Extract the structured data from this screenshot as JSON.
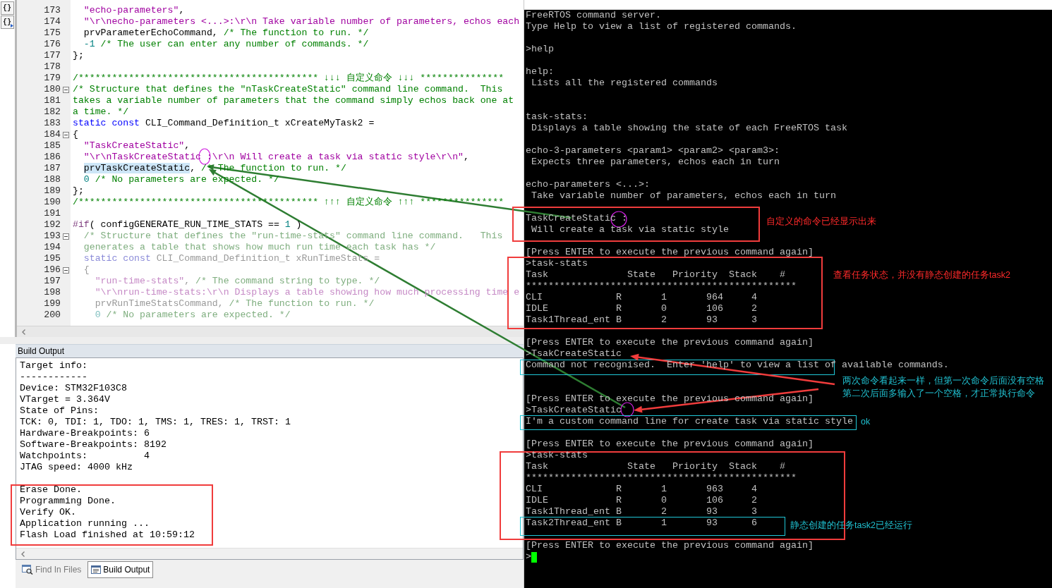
{
  "toolbar": [
    {
      "kind": "braces",
      "label": "{}"
    },
    {
      "kind": "braces_arrow",
      "label": "{}"
    }
  ],
  "editor": {
    "lines": [
      {
        "number": "173",
        "fold": false,
        "inactive": false,
        "tokens": [
          {
            "kind": "string",
            "text": "  \"echo-parameters\""
          },
          {
            "kind": "plain",
            "text": ","
          }
        ]
      },
      {
        "number": "174",
        "fold": false,
        "inactive": false,
        "tokens": [
          {
            "kind": "string",
            "text": "  \"\\r\\necho-parameters <...>:\\r\\n Take variable number of parameters, echos each"
          }
        ]
      },
      {
        "number": "175",
        "fold": false,
        "inactive": false,
        "tokens": [
          {
            "kind": "plain",
            "text": "  prvParameterEchoCommand, "
          },
          {
            "kind": "comment",
            "text": "/* The function to run. */"
          }
        ]
      },
      {
        "number": "176",
        "fold": false,
        "inactive": false,
        "tokens": [
          {
            "kind": "number",
            "text": "  -1"
          },
          {
            "kind": "comment",
            "text": " /* The user can enter any number of commands. */"
          }
        ]
      },
      {
        "number": "177",
        "fold": false,
        "inactive": false,
        "tokens": [
          {
            "kind": "plain",
            "text": "};"
          }
        ]
      },
      {
        "number": "178",
        "fold": false
      },
      {
        "number": "179",
        "fold": false,
        "inactive": false,
        "tokens": [
          {
            "kind": "comment",
            "text": "/******************************************* ↓↓↓ 自定义命令 ↓↓↓ ***************"
          }
        ]
      },
      {
        "number": "180",
        "fold": true,
        "inactive": false,
        "tokens": [
          {
            "kind": "comment",
            "text": "/* Structure that defines the \"nTaskCreateStatic\" command line command.  This"
          }
        ]
      },
      {
        "number": "181",
        "fold": false,
        "inactive": false,
        "tokens": [
          {
            "kind": "comment",
            "text": "takes a variable number of parameters that the command simply echos back one at"
          }
        ]
      },
      {
        "number": "182",
        "fold": false,
        "inactive": false,
        "tokens": [
          {
            "kind": "comment",
            "text": "a time. */"
          }
        ]
      },
      {
        "number": "183",
        "fold": false,
        "inactive": false,
        "tokens": [
          {
            "kind": "keyword",
            "text": "static const"
          },
          {
            "kind": "plain",
            "text": " CLI_Command_Definition_t xCreateMyTask2 ="
          }
        ]
      },
      {
        "number": "184",
        "fold": true,
        "inactive": false,
        "tokens": [
          {
            "kind": "plain",
            "text": "{"
          }
        ]
      },
      {
        "number": "185",
        "fold": false,
        "inactive": false,
        "tokens": [
          {
            "kind": "string",
            "text": "  \"TaskCreateStatic\""
          },
          {
            "kind": "plain",
            "text": ","
          }
        ]
      },
      {
        "number": "186",
        "fold": false,
        "inactive": false,
        "tokens": [
          {
            "kind": "string",
            "text": "  \"\\r\\nTaskCreateStatic :\\r\\n Will create a task via static style\\r\\n\""
          },
          {
            "kind": "plain",
            "text": ","
          }
        ]
      },
      {
        "number": "187",
        "fold": false,
        "inactive": false,
        "tokens": [
          {
            "kind": "highlight",
            "text": "  prvTaskCreateStatic"
          },
          {
            "kind": "plain",
            "text": ", "
          },
          {
            "kind": "comment",
            "text": "/* The function to run. */"
          }
        ]
      },
      {
        "number": "188",
        "fold": false,
        "inactive": false,
        "tokens": [
          {
            "kind": "number",
            "text": "  0"
          },
          {
            "kind": "comment",
            "text": " /* No parameters are expected. */"
          }
        ]
      },
      {
        "number": "189",
        "fold": false,
        "inactive": false,
        "tokens": [
          {
            "kind": "plain",
            "text": "};"
          }
        ]
      },
      {
        "number": "190",
        "fold": false,
        "inactive": false,
        "tokens": [
          {
            "kind": "comment",
            "text": "/******************************************* ↑↑↑ 自定义命令 ↑↑↑ ***************"
          }
        ]
      },
      {
        "number": "191",
        "fold": false
      },
      {
        "number": "192",
        "fold": false,
        "inactive": false,
        "tokens": [
          {
            "kind": "preproc",
            "text": "#if"
          },
          {
            "kind": "plain",
            "text": "( configGENERATE_RUN_TIME_STATS == "
          },
          {
            "kind": "number",
            "text": "1"
          },
          {
            "kind": "plain",
            "text": " )"
          }
        ]
      },
      {
        "number": "193",
        "fold": true,
        "inactive": true,
        "tokens": [
          {
            "kind": "comment",
            "text": "  /* Structure that defines the \"run-time-stats\" command line command.   This"
          }
        ]
      },
      {
        "number": "194",
        "fold": false,
        "inactive": true,
        "tokens": [
          {
            "kind": "comment",
            "text": "  generates a table that shows how much run time each task has */"
          }
        ]
      },
      {
        "number": "195",
        "fold": false,
        "inactive": true,
        "tokens": [
          {
            "kind": "keyword",
            "text": "  static const"
          },
          {
            "kind": "plain",
            "text": " CLI_Command_Definition_t xRunTimeStats ="
          }
        ]
      },
      {
        "number": "196",
        "fold": true,
        "inactive": true,
        "tokens": [
          {
            "kind": "plain",
            "text": "  {"
          }
        ]
      },
      {
        "number": "197",
        "fold": false,
        "inactive": true,
        "tokens": [
          {
            "kind": "string",
            "text": "    \"run-time-stats\""
          },
          {
            "kind": "plain",
            "text": ", "
          },
          {
            "kind": "comment",
            "text": "/* The command string to type. */"
          }
        ]
      },
      {
        "number": "198",
        "fold": false,
        "inactive": true,
        "tokens": [
          {
            "kind": "string",
            "text": "    \"\\r\\nrun-time-stats:\\r\\n Displays a table showing how much processing time e"
          }
        ]
      },
      {
        "number": "199",
        "fold": false,
        "inactive": true,
        "tokens": [
          {
            "kind": "plain",
            "text": "    prvRunTimeStatsCommand, "
          },
          {
            "kind": "comment",
            "text": "/* The function to run. */"
          }
        ]
      },
      {
        "number": "200",
        "fold": false,
        "inactive": true,
        "tokens": [
          {
            "kind": "number",
            "text": "    0"
          },
          {
            "kind": "comment",
            "text": " /* No parameters are expected. */"
          }
        ]
      }
    ]
  },
  "build_output": {
    "title": "Build Output",
    "blocks": [
      [
        "Target info:",
        "------------",
        "Device: STM32F103C8",
        "VTarget = 3.364V",
        "State of Pins:",
        "TCK: 0, TDI: 1, TDO: 1, TMS: 1, TRES: 1, TRST: 1",
        "Hardware-Breakpoints: 6",
        "Software-Breakpoints: 8192",
        "Watchpoints:          4",
        "JTAG speed: 4000 kHz"
      ],
      [
        "Erase Done.",
        "Programming Done.",
        "Verify OK.",
        "Application running ...",
        "Flash Load finished at 10:59:12"
      ]
    ]
  },
  "bottom_tabs": [
    {
      "label": "Find In Files",
      "selected": false
    },
    {
      "label": "Build Output",
      "selected": true
    }
  ],
  "terminal": {
    "cursor": true,
    "lines": [
      {
        "kind": "text",
        "text": "FreeRTOS command server."
      },
      {
        "kind": "text",
        "text": "Type Help to view a list of registered commands."
      },
      {
        "kind": "blank"
      },
      {
        "kind": "text",
        "text": ">help"
      },
      {
        "kind": "blank"
      },
      {
        "kind": "text",
        "text": "help:"
      },
      {
        "kind": "text",
        "text": " Lists all the registered commands"
      },
      {
        "kind": "blank"
      },
      {
        "kind": "blank"
      },
      {
        "kind": "text",
        "text": "task-stats:"
      },
      {
        "kind": "text",
        "text": " Displays a table showing the state of each FreeRTOS task"
      },
      {
        "kind": "blank"
      },
      {
        "kind": "text",
        "text": "echo-3-parameters <param1> <param2> <param3>:"
      },
      {
        "kind": "text",
        "text": " Expects three parameters, echos each in turn"
      },
      {
        "kind": "blank"
      },
      {
        "kind": "text",
        "text": "echo-parameters <...>:"
      },
      {
        "kind": "text",
        "text": " Take variable number of parameters, echos each in turn"
      },
      {
        "kind": "blank"
      },
      {
        "kind": "text",
        "text": "TaskCreateStatic :"
      },
      {
        "kind": "text",
        "text": " Will create a task via static style"
      },
      {
        "kind": "blank"
      },
      {
        "kind": "text",
        "text": "[Press ENTER to execute the previous command again]"
      },
      {
        "kind": "text",
        "text": ">task-stats"
      },
      {
        "kind": "text",
        "text": "Task              State   Priority  Stack    #"
      },
      {
        "kind": "text",
        "text": "************************************************"
      },
      {
        "kind": "text",
        "text": "CLI             R       1       964     4"
      },
      {
        "kind": "text",
        "text": "IDLE            R       0       106     2"
      },
      {
        "kind": "text",
        "text": "Task1Thread_ent B       2       93      3"
      },
      {
        "kind": "blank"
      },
      {
        "kind": "text",
        "text": "[Press ENTER to execute the previous command again]"
      },
      {
        "kind": "text",
        "text": ">TsakCreateStatic"
      },
      {
        "kind": "text",
        "text": "Command not recognised.  Enter 'help' to view a list of available commands."
      },
      {
        "kind": "blank"
      },
      {
        "kind": "blank"
      },
      {
        "kind": "text",
        "text": "[Press ENTER to execute the previous command again]"
      },
      {
        "kind": "text",
        "text": ">TaskCreateStatic"
      },
      {
        "kind": "text",
        "text": "I'm a custom command line for create task via static style"
      },
      {
        "kind": "blank"
      },
      {
        "kind": "text",
        "text": "[Press ENTER to execute the previous command again]"
      },
      {
        "kind": "text",
        "text": ">task-stats"
      },
      {
        "kind": "text",
        "text": "Task              State   Priority  Stack    #"
      },
      {
        "kind": "text",
        "text": "************************************************"
      },
      {
        "kind": "text",
        "text": "CLI             R       1       963     4"
      },
      {
        "kind": "text",
        "text": "IDLE            R       0       106     2"
      },
      {
        "kind": "text",
        "text": "Task1Thread_ent B       2       93      3"
      },
      {
        "kind": "text",
        "text": "Task2Thread_ent B       1       93      6"
      },
      {
        "kind": "blank"
      },
      {
        "kind": "text",
        "text": "[Press ENTER to execute the previous command again]"
      },
      {
        "kind": "text",
        "text": ">"
      }
    ]
  },
  "annotations": [
    {
      "kind": "ellipse",
      "color": "#d020e0"
    },
    {
      "kind": "arrow",
      "color": "#2e7d32"
    },
    {
      "kind": "arrow",
      "color": "#2e7d32"
    },
    {
      "kind": "box",
      "color": "#f03c3c"
    },
    {
      "kind": "ellipse",
      "color": "#d020e0"
    },
    {
      "kind": "note",
      "color": "#ff2a2a",
      "text": "自定义的命令已经显示出来"
    },
    {
      "kind": "box",
      "color": "#f03c3c"
    },
    {
      "kind": "note",
      "color": "#ff2a2a",
      "text": "查看任务状态，并没有静态创建的任务task2"
    },
    {
      "kind": "box",
      "color": "#20c8d8"
    },
    {
      "kind": "arrow",
      "color": "#f03c3c"
    },
    {
      "kind": "note",
      "color": "#20c0d0",
      "text": "两次命令看起来一样，但第一次命令后面没有空格"
    },
    {
      "kind": "note",
      "color": "#20c0d0",
      "text": "第二次后面多输入了一个空格，才正常执行命令"
    },
    {
      "kind": "arrow",
      "color": "#f03c3c"
    },
    {
      "kind": "ellipse",
      "color": "#d020e0"
    },
    {
      "kind": "box",
      "color": "#20c8d8"
    },
    {
      "kind": "note",
      "color": "#20c0d0",
      "text": "ok"
    },
    {
      "kind": "box",
      "color": "#f03c3c"
    },
    {
      "kind": "box",
      "color": "#20c8d8"
    },
    {
      "kind": "note",
      "color": "#20c0d0",
      "text": "静态创建的任务task2已经运行"
    },
    {
      "kind": "box",
      "color": "#f03c3c"
    }
  ]
}
